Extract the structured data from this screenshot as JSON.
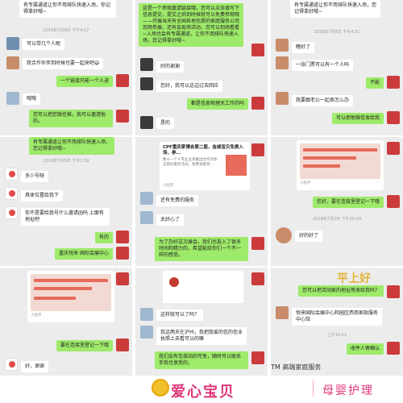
{
  "panel1": {
    "top_text": "有专属通道让你不用排队快速入场，你记得拿好哦~",
    "timestamp": "2019年7月9日 下午4:17",
    "msg1": "可以带几个人呢",
    "msg2": "我合作伙伴到时候也要一起来吧😄",
    "msg3": "一个链接只能一个人进",
    "msg4": "哦哦",
    "msg5": "您可以把您微信推，我可以邀请他的。"
  },
  "panel2": {
    "top_text": "这是一个参观邀请链接哦，您可以点击填写下信息提交，提交之后到时候就可以免费参观哦——开展当天有全国各地优质的家庭服务公司到场参展，还有会现场活动，您可以到场看看~入场也会有专属通道，让你不用排队快速入场，您记得拿好哦~",
    "msg1": "好的谢谢",
    "msg2": "您好，我可以这边过去回应",
    "msg3": "都是信息物理关工作的吗",
    "msg4": "是的"
  },
  "panel3": {
    "top_text": "有专属通道让你不用排队快速入场，您记得拿好哦~",
    "timestamp": "2019年7月8日 下午4:31",
    "msg1": "瞎好了",
    "msg2": "一张门票可以有一个人吗",
    "msg3": "不能",
    "msg4": "我要跟老公一起表怎么办",
    "msg5": "可以把他微信发给我"
  },
  "panel4": {
    "top_text": "有专属通道让你不用排队快速入场，您记得拿好哦~",
    "timestamp": "2019年7月5日 下午1:59",
    "msg1": "多少号呀",
    "msg2": "具体位置给我下",
    "msg3": "你不是要给我号什么邀请函吗 上面有地址吧",
    "msg4": "有的",
    "msg5": "重庆悦来 国际会展中心"
  },
  "panel5": {
    "card_title": "CPF重庆家博会第二届，金城宝贝免费入场，参…",
    "card_desc": "数十一个人专业业务推出合作对你这家好服务活动，免费领取领…",
    "card_src": "小程序",
    "msg1": "还有免费的服务",
    "msg2": "太好心了",
    "msg3": "为了办好这次展会，我们也投入了很多时间和精力的，希望能给你们一个不一样的感受。"
  },
  "panel6": {
    "card_title": "",
    "card_src": "小程序",
    "msg1": "您好，要在连接里登记一下哦",
    "timestamp": "2019年7月2日 下午10:39",
    "msg2": "好的好了"
  },
  "panel7": {
    "card_src": "小程序",
    "msg1": "要在连接里登记一下哦",
    "msg2": "好，谢谢"
  },
  "panel8": {
    "msg1": "这样就可以了吗？",
    "msg2": "我这两天在泸州，我把我爱的信的信业执照上去看可以的嘛",
    "msg3": "我们会有车接站的可免，随时可以联系手我也享受的。"
  },
  "panel9": {
    "banner": "平上好",
    "msg1": "您可以把活动家的地址等发给我吗？",
    "msg2": "悦来国际会展中心和园区西南家政服务中心馆",
    "timestamp": "上午10:12",
    "msg3": "收件人寄确认",
    "brand_tm": "TM 高端家庭服务"
  },
  "footer": {
    "brand_main": "爱心宝贝",
    "brand_sub": "母婴护理"
  }
}
